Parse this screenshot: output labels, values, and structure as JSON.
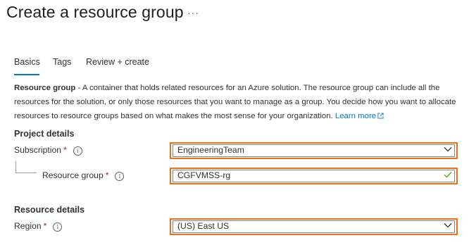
{
  "header": {
    "title": "Create a resource group",
    "more_label": "···"
  },
  "tabs": [
    {
      "label": "Basics"
    },
    {
      "label": "Tags"
    },
    {
      "label": "Review + create"
    }
  ],
  "description": {
    "bold_text": "Resource group",
    "body_text": " - A container that holds related resources for an Azure solution. The resource group can include all the resources for the solution, or only those resources that you want to manage as a group. You decide how you want to allocate resources to resource groups based on what makes the most sense for your organization. ",
    "link_text": "Learn more"
  },
  "project_details": {
    "heading": "Project details",
    "subscription": {
      "label": "Subscription",
      "value": "EngineeringTeam"
    },
    "resource_group": {
      "label": "Resource group",
      "value": "CGFVMSS-rg"
    }
  },
  "resource_details": {
    "heading": "Resource details",
    "region": {
      "label": "Region",
      "value": "(US) East US"
    }
  },
  "required_marker": "*",
  "info_glyph": "i",
  "colors": {
    "accent": "#0078d4",
    "highlight": "#e8711c",
    "valid": "#57a300",
    "required": "#a4262c"
  }
}
